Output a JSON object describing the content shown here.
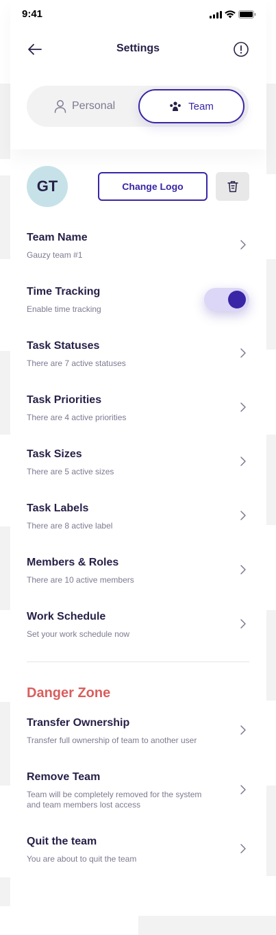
{
  "status_bar": {
    "time": "9:41"
  },
  "header": {
    "title": "Settings"
  },
  "segment": {
    "personal_label": "Personal",
    "team_label": "Team"
  },
  "logo": {
    "initials": "GT",
    "change_label": "Change Logo"
  },
  "settings": [
    {
      "title": "Team Name",
      "subtitle": "Gauzy team #1"
    },
    {
      "title": "Time Tracking",
      "subtitle": "Enable time tracking",
      "toggle_on": true
    },
    {
      "title": "Task Statuses",
      "subtitle": "There are 7 active statuses"
    },
    {
      "title": "Task Priorities",
      "subtitle": "There are 4 active priorities"
    },
    {
      "title": "Task Sizes",
      "subtitle": "There are 5 active sizes"
    },
    {
      "title": "Task Labels",
      "subtitle": "There are 8 active label"
    },
    {
      "title": "Members & Roles",
      "subtitle": "There are 10 active members"
    },
    {
      "title": "Work Schedule",
      "subtitle": "Set your work schedule now"
    }
  ],
  "danger_zone": {
    "title": "Danger Zone",
    "items": [
      {
        "title": "Transfer Ownership",
        "subtitle": "Transfer full ownership of team to another user"
      },
      {
        "title": "Remove Team",
        "subtitle": "Team will be completely removed for the system and team members lost access"
      },
      {
        "title": "Quit the team",
        "subtitle": "You are about to quit the team"
      }
    ]
  },
  "colors": {
    "accent": "#3826a6",
    "danger": "#da5e5e",
    "text": "#282048",
    "muted": "#7e7991"
  }
}
